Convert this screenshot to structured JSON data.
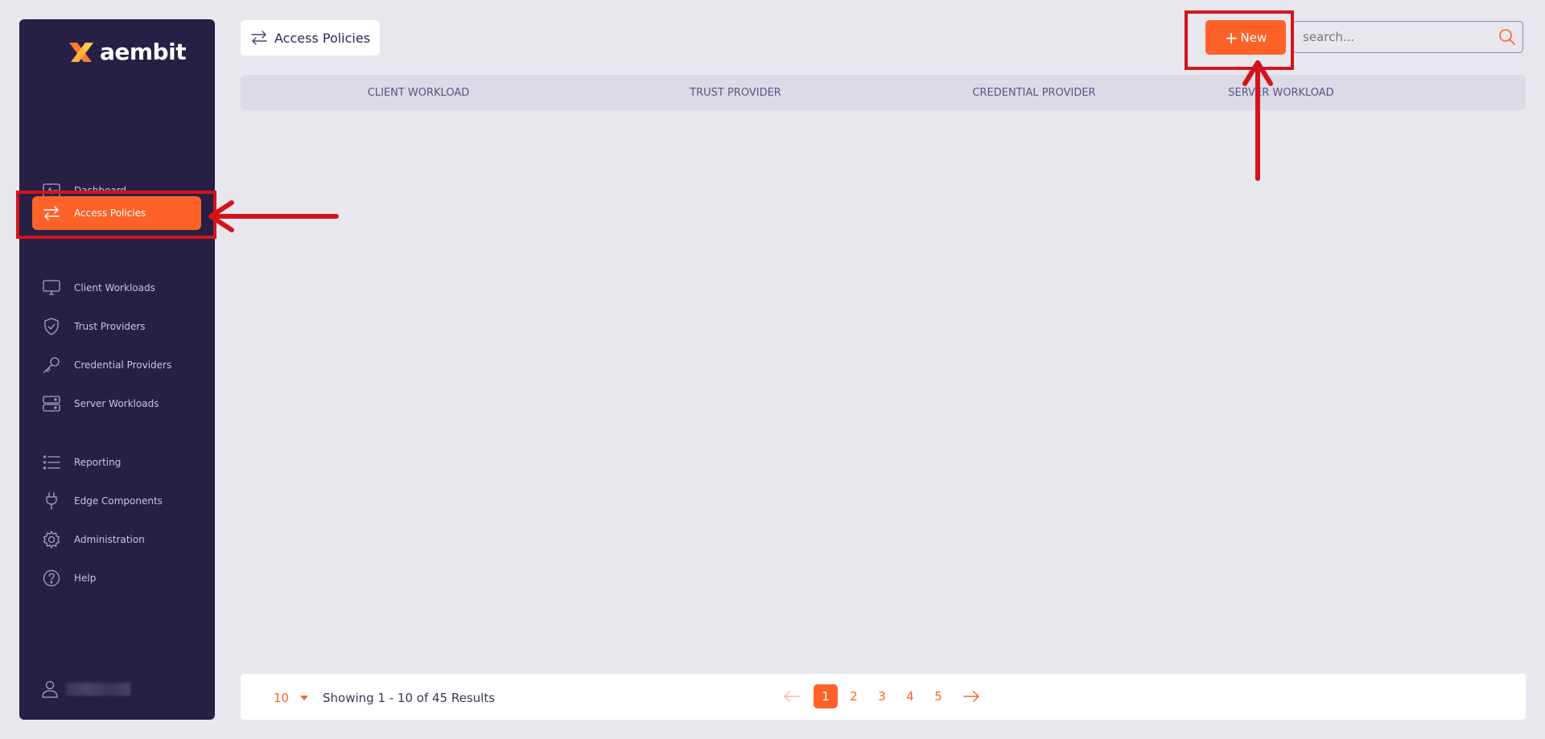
{
  "app": {
    "logo_text": "aembit"
  },
  "sidebar": {
    "items": [
      {
        "label": "Dashboard",
        "icon": "activity-monitor-icon"
      },
      {
        "label": "Access Policies",
        "icon": "swap-arrows-icon",
        "active": true
      },
      {
        "label": "Client Workloads",
        "icon": "monitor-icon"
      },
      {
        "label": "Trust Providers",
        "icon": "shield-check-icon"
      },
      {
        "label": "Credential Providers",
        "icon": "key-icon"
      },
      {
        "label": "Server Workloads",
        "icon": "server-icon"
      },
      {
        "label": "Reporting",
        "icon": "list-icon"
      },
      {
        "label": "Edge Components",
        "icon": "plug-icon"
      },
      {
        "label": "Administration",
        "icon": "gear-icon"
      },
      {
        "label": "Help",
        "icon": "help-circle-icon"
      }
    ],
    "user_icon": "user-icon"
  },
  "header": {
    "title": "Access Policies",
    "new_button_label": "New",
    "search_placeholder": "search..."
  },
  "table": {
    "columns": [
      "CLIENT WORKLOAD",
      "TRUST PROVIDER",
      "CREDENTIAL PROVIDER",
      "SERVER WORKLOAD"
    ]
  },
  "footer": {
    "per_page": "10",
    "showing": "Showing 1 - 10 of 45 Results",
    "pages": [
      "1",
      "2",
      "3",
      "4",
      "5"
    ],
    "current_page": "1"
  },
  "colors": {
    "accent": "#ff6229",
    "sidebar_bg": "#262045",
    "annotation": "#d4141b"
  }
}
